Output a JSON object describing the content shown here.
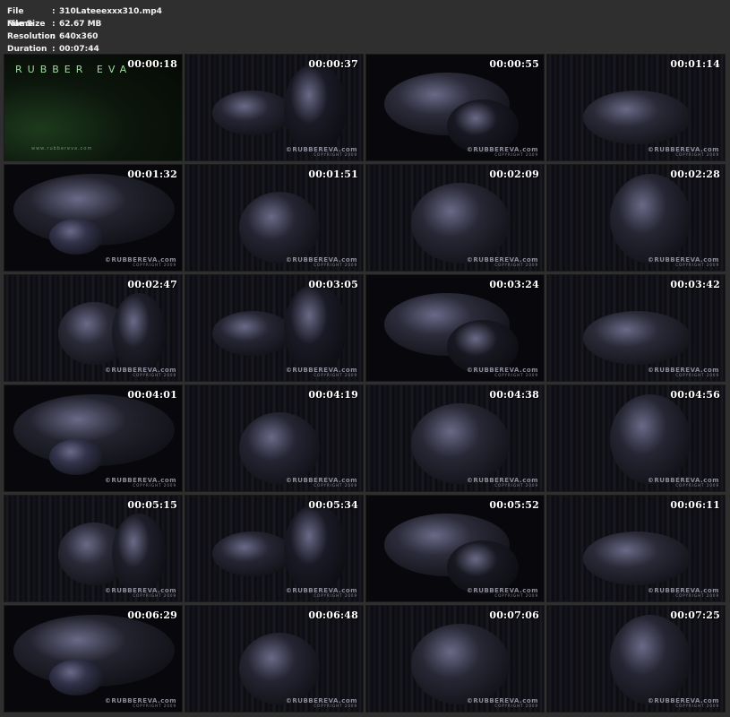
{
  "file_info": [
    {
      "label": "File Name",
      "sep": ":",
      "value": "310Lateeexxx310.mp4"
    },
    {
      "label": "File Size",
      "sep": ":",
      "value": "62.67 MB"
    },
    {
      "label": "Resolution",
      "sep": ":",
      "value": "640x360"
    },
    {
      "label": "Duration",
      "sep": ":",
      "value": "00:07:44"
    }
  ],
  "title_card": {
    "logo": "RUBBER EVA",
    "url": "www.rubbereva.com"
  },
  "watermark": {
    "line1": "©RUBBEREVA.com",
    "line2": "COPYRIGHT 2009"
  },
  "thumbnails": [
    {
      "time": "00:00:18"
    },
    {
      "time": "00:00:37"
    },
    {
      "time": "00:00:55"
    },
    {
      "time": "00:01:14"
    },
    {
      "time": "00:01:32"
    },
    {
      "time": "00:01:51"
    },
    {
      "time": "00:02:09"
    },
    {
      "time": "00:02:28"
    },
    {
      "time": "00:02:47"
    },
    {
      "time": "00:03:05"
    },
    {
      "time": "00:03:24"
    },
    {
      "time": "00:03:42"
    },
    {
      "time": "00:04:01"
    },
    {
      "time": "00:04:19"
    },
    {
      "time": "00:04:38"
    },
    {
      "time": "00:04:56"
    },
    {
      "time": "00:05:15"
    },
    {
      "time": "00:05:34"
    },
    {
      "time": "00:05:52"
    },
    {
      "time": "00:06:11"
    },
    {
      "time": "00:06:29"
    },
    {
      "time": "00:06:48"
    },
    {
      "time": "00:07:06"
    },
    {
      "time": "00:07:25"
    }
  ],
  "colors": {
    "background": "#2f2f2f",
    "text": "#f2f2f2",
    "scene_dark": "#08080c"
  }
}
